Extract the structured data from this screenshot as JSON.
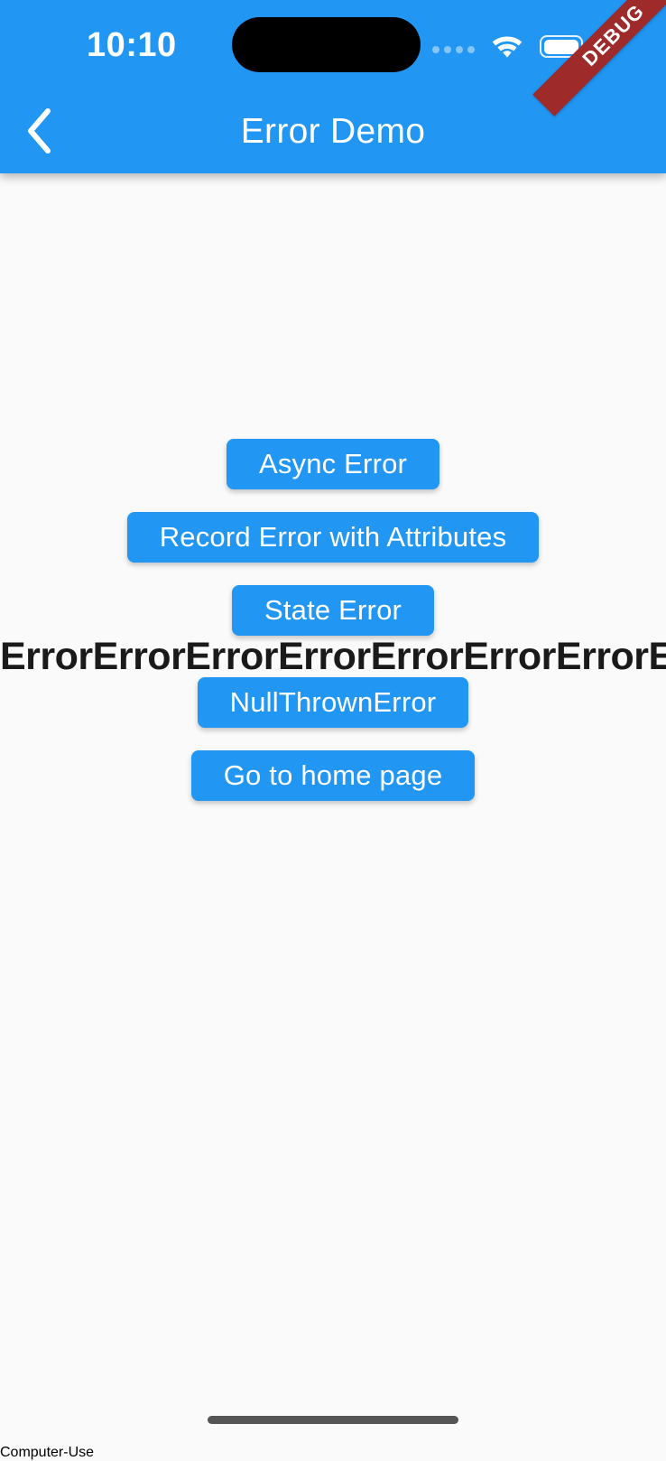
{
  "status_bar": {
    "time": "10:10",
    "cellular_icon": "cellular-dots-icon",
    "cellular_dots": 4,
    "wifi_icon": "wifi-icon",
    "battery_icon": "battery-full-icon"
  },
  "app_bar": {
    "title": "Error Demo",
    "back_icon": "chevron-left-icon",
    "background_color": "#2196f3",
    "text_color": "#ffffff"
  },
  "debug_banner": {
    "label": "DEBUG",
    "background_color": "#9e2a2a",
    "text_color": "#ffffff"
  },
  "main": {
    "background_color": "#fafafa",
    "buttons": [
      {
        "label": "Async Error"
      },
      {
        "label": "Record Error with Attributes"
      },
      {
        "label": "State Error"
      },
      {
        "label": "NullThrownError"
      },
      {
        "label": "Go to home page"
      }
    ],
    "overflow_text": "ErrorErrorErrorErrorErrorErrorErrorErrorErrorErrorErrorError",
    "overflow_text_color": "#1a1a1a"
  },
  "home_indicator": {
    "color": "#555555"
  }
}
